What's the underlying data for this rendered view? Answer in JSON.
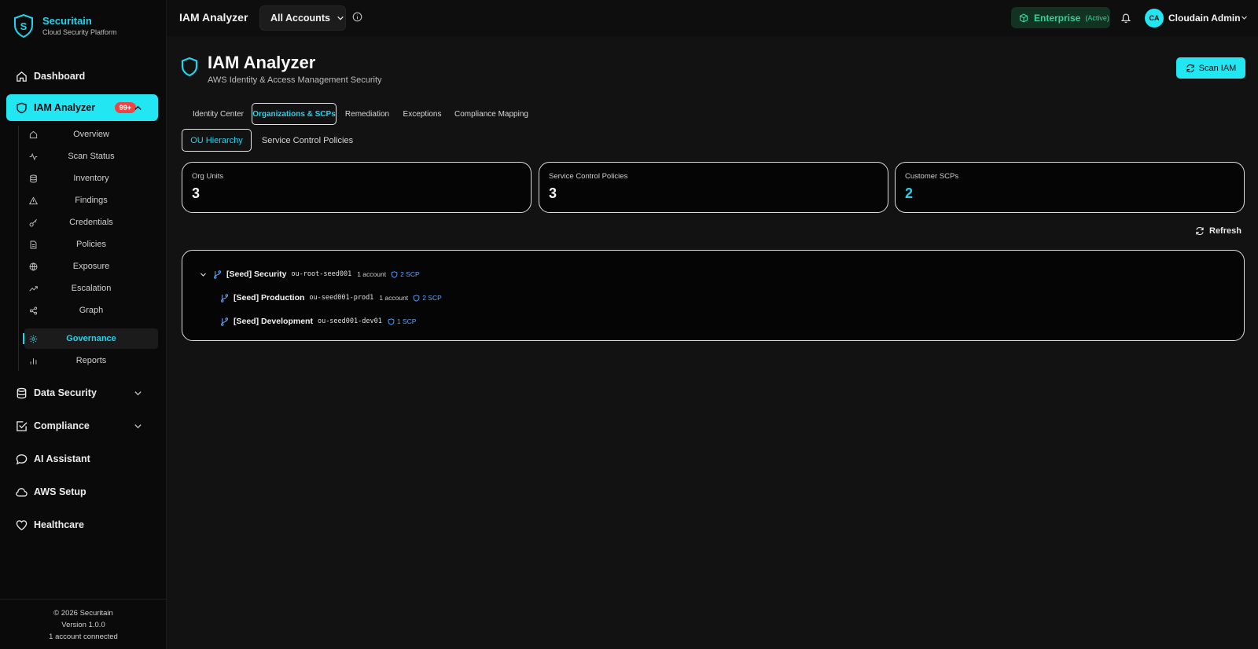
{
  "brand": {
    "name": "Securitain",
    "tagline": "Cloud Security Platform",
    "logo_letter": "S"
  },
  "colors": {
    "accent": "#22e6f2",
    "badge": "#ef4444",
    "plan": "#34d399",
    "scp": "#60a5fa"
  },
  "sidebar": {
    "items": [
      {
        "label": "Dashboard",
        "icon": "home-icon"
      },
      {
        "label": "IAM Analyzer",
        "icon": "shield-icon",
        "badge": "99+",
        "active": true
      },
      {
        "label": "Data Security",
        "icon": "database-icon"
      },
      {
        "label": "Compliance",
        "icon": "checkbox-icon"
      },
      {
        "label": "AI Assistant",
        "icon": "chat-icon"
      },
      {
        "label": "AWS Setup",
        "icon": "cloud-icon"
      },
      {
        "label": "Healthcare",
        "icon": "heart-icon"
      }
    ],
    "subitems": [
      {
        "label": "Overview",
        "icon": "home-icon"
      },
      {
        "label": "Scan Status",
        "icon": "activity-icon"
      },
      {
        "label": "Inventory",
        "icon": "database-icon"
      },
      {
        "label": "Findings",
        "icon": "warning-icon"
      },
      {
        "label": "Credentials",
        "icon": "key-icon"
      },
      {
        "label": "Policies",
        "icon": "file-icon"
      },
      {
        "label": "Exposure",
        "icon": "globe-icon"
      },
      {
        "label": "Escalation",
        "icon": "trending-up-icon"
      },
      {
        "label": "Graph",
        "icon": "share-icon"
      },
      {
        "label": "Governance",
        "icon": "gear-icon",
        "active": true
      },
      {
        "label": "Reports",
        "icon": "bar-chart-icon"
      }
    ],
    "footer": {
      "copyright": "© 2026 Securitain",
      "version": "Version 1.0.0",
      "accounts": "1 account connected"
    }
  },
  "topbar": {
    "title": "IAM Analyzer",
    "account_select": "All Accounts",
    "plan": "Enterprise",
    "plan_status": "(Active)",
    "user_initials": "CA",
    "user_name": "Cloudain Admin"
  },
  "page": {
    "title": "IAM Analyzer",
    "subtitle": "AWS Identity & Access Management Security",
    "scan_button": "Scan IAM"
  },
  "tabs": [
    {
      "label": "Identity Center"
    },
    {
      "label": "Organizations & SCPs",
      "active": true
    },
    {
      "label": "Remediation"
    },
    {
      "label": "Exceptions"
    },
    {
      "label": "Compliance Mapping"
    }
  ],
  "subtabs": [
    {
      "label": "OU Hierarchy",
      "active": true
    },
    {
      "label": "Service Control Policies"
    }
  ],
  "stats": [
    {
      "label": "Org Units",
      "value": "3"
    },
    {
      "label": "Service Control Policies",
      "value": "3"
    },
    {
      "label": "Customer SCPs",
      "value": "2"
    }
  ],
  "refresh_label": "Refresh",
  "ou_tree": [
    {
      "name": "[Seed] Security",
      "id": "ou-root-seed001",
      "accounts": "1 account",
      "scps": "2 SCP"
    },
    {
      "name": "[Seed] Production",
      "id": "ou-seed001-prod1",
      "accounts": "1 account",
      "scps": "2 SCP"
    },
    {
      "name": "[Seed] Development",
      "id": "ou-seed001-dev01",
      "accounts": "",
      "scps": "1 SCP"
    }
  ]
}
